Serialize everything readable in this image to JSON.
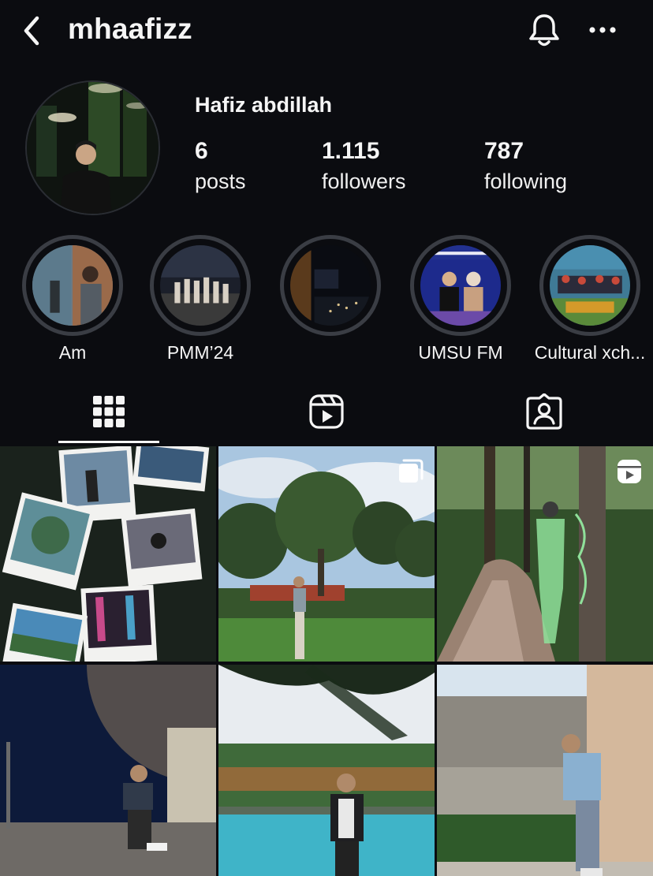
{
  "header": {
    "username": "mhaafizz",
    "back_icon": "chevron-left-icon",
    "notification_icon": "bell-icon",
    "more_icon": "more-horizontal-icon"
  },
  "profile": {
    "display_name": "Hafiz abdillah",
    "stats": [
      {
        "value": "6",
        "label": "posts"
      },
      {
        "value": "1.115",
        "label": "followers"
      },
      {
        "value": "787",
        "label": "following"
      }
    ]
  },
  "highlights": [
    {
      "label": "Am"
    },
    {
      "label": "PMM’24"
    },
    {
      "label": ""
    },
    {
      "label": "UMSU FM"
    },
    {
      "label": "Cultural xch..."
    }
  ],
  "tabs": [
    {
      "name": "posts-grid",
      "icon": "grid-icon",
      "active": true
    },
    {
      "name": "reels",
      "icon": "reels-icon",
      "active": false
    },
    {
      "name": "tagged",
      "icon": "tagged-person-icon",
      "active": false
    }
  ],
  "posts": [
    {
      "badge": "none"
    },
    {
      "badge": "carousel-icon"
    },
    {
      "badge": "reel-icon"
    },
    {
      "badge": "none"
    },
    {
      "badge": "none"
    },
    {
      "badge": "none"
    }
  ],
  "colors": {
    "background": "#0b0c10",
    "text": "#f5f5f5",
    "highlight_ring": "#3a3d44"
  }
}
